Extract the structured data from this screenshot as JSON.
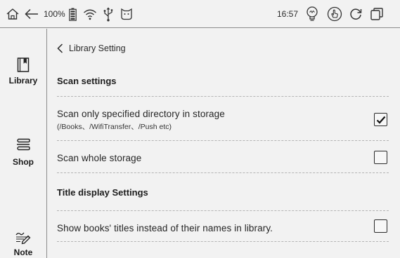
{
  "status_bar": {
    "battery_percent": "100%",
    "clock": "16:57",
    "icons": [
      "home-icon",
      "back-arrow-icon",
      "battery-icon",
      "wifi-icon",
      "usb-icon",
      "cat-icon",
      "bulb-icon",
      "touch-icon",
      "refresh-icon",
      "window-icon"
    ]
  },
  "sidebar": {
    "items": [
      {
        "label": "Library",
        "icon": "library-icon"
      },
      {
        "label": "Shop",
        "icon": "shop-icon"
      },
      {
        "label": "Note",
        "icon": "note-icon"
      }
    ]
  },
  "page": {
    "back_label": "Library Setting",
    "sections": [
      {
        "title": "Scan settings",
        "options": [
          {
            "label": "Scan only specified directory in storage",
            "sublabel": "(/Books、/WifiTransfer、/Push etc)",
            "checked": true
          },
          {
            "label": "Scan whole storage",
            "checked": false
          }
        ]
      },
      {
        "title": "Title display Settings",
        "options": [
          {
            "label": "Show books' titles instead of their names in library.",
            "checked": false
          }
        ]
      }
    ]
  }
}
